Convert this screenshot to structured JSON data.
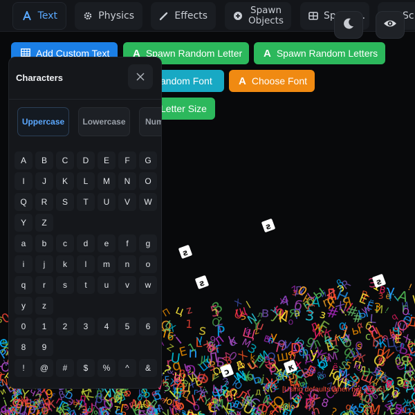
{
  "tabs": [
    {
      "label": "Text",
      "icon": "text-icon",
      "active": true
    },
    {
      "label": "Physics",
      "icon": "gear-icon",
      "active": false
    },
    {
      "label": "Effects",
      "icon": "wand-icon",
      "active": false
    },
    {
      "label": "Spawn\nObjects",
      "icon": "plus-circle-icon",
      "active": false
    },
    {
      "label": "Spawn...",
      "icon": "grid-icon",
      "active": false
    },
    {
      "label": "Sc",
      "icon": "branch-icon",
      "active": false
    }
  ],
  "buttons": {
    "add_custom_text": "Add Custom Text",
    "spawn_random_letter": "Spawn Random Letter",
    "spawn_random_letters": "Spawn Random Letters",
    "random_font": "andom Font",
    "choose_font": "Choose Font",
    "letter_size": "Letter Size"
  },
  "panel": {
    "title": "Characters",
    "categories": [
      "Uppercase",
      "Lowercase",
      "Num"
    ],
    "selected_category": "Uppercase",
    "uppercase": [
      "A",
      "B",
      "C",
      "D",
      "E",
      "F",
      "G",
      "I",
      "J",
      "K",
      "L",
      "M",
      "N",
      "O",
      "Q",
      "R",
      "S",
      "T",
      "U",
      "V",
      "W",
      "Y",
      "Z"
    ],
    "lowercase": [
      "a",
      "b",
      "c",
      "d",
      "e",
      "f",
      "g",
      "i",
      "j",
      "k",
      "l",
      "m",
      "n",
      "o",
      "q",
      "r",
      "s",
      "t",
      "u",
      "v",
      "w",
      "y",
      "z"
    ],
    "numbers": [
      "0",
      "1",
      "2",
      "3",
      "4",
      "5",
      "6",
      "8",
      "9"
    ],
    "symbols": [
      "!",
      "@",
      "#",
      "$",
      "%",
      "^",
      "&"
    ]
  },
  "footer_note": "[Using defaults when not active]",
  "colors": {
    "accent_blue": "#5aa9ff",
    "btn_blue": "#1b7fe6",
    "btn_green": "#2cb85c",
    "btn_teal": "#18a9c4",
    "btn_orange": "#f08a12"
  }
}
